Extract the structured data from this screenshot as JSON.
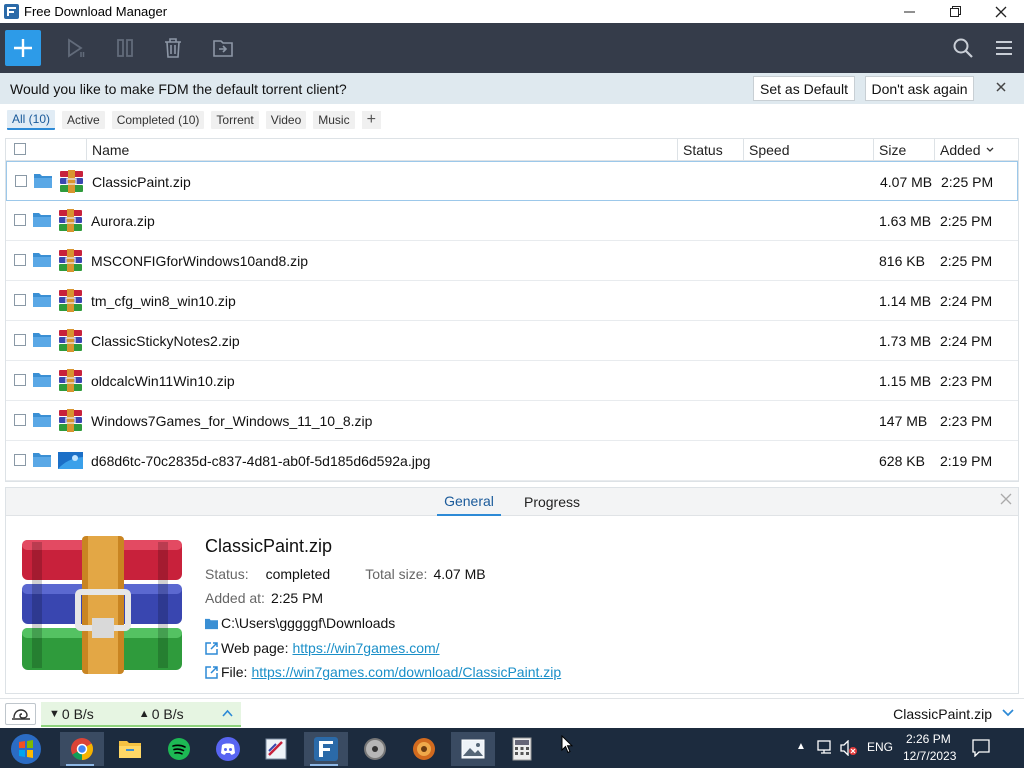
{
  "window": {
    "title": "Free Download Manager"
  },
  "notification": {
    "text": "Would you like to make FDM the default torrent client?",
    "set_default": "Set as Default",
    "dont_ask": "Don't ask again"
  },
  "filters": [
    "All (10)",
    "Active",
    "Completed (10)",
    "Torrent",
    "Video",
    "Music"
  ],
  "columns": {
    "name": "Name",
    "status": "Status",
    "speed": "Speed",
    "size": "Size",
    "added": "Added"
  },
  "downloads": [
    {
      "name": "ClassicPaint.zip",
      "size": "4.07 MB",
      "added": "2:25 PM"
    },
    {
      "name": "Aurora.zip",
      "size": "1.63 MB",
      "added": "2:25 PM"
    },
    {
      "name": "MSCONFIGforWindows10and8.zip",
      "size": "816 KB",
      "added": "2:25 PM"
    },
    {
      "name": "tm_cfg_win8_win10.zip",
      "size": "1.14 MB",
      "added": "2:24 PM"
    },
    {
      "name": "ClassicStickyNotes2.zip",
      "size": "1.73 MB",
      "added": "2:24 PM"
    },
    {
      "name": "oldcalcWin11Win10.zip",
      "size": "1.15 MB",
      "added": "2:23 PM"
    },
    {
      "name": "Windows7Games_for_Windows_11_10_8.zip",
      "size": "147 MB",
      "added": "2:23 PM"
    },
    {
      "name": "d68d6tc-70c2835d-c837-4d81-ab0f-5d185d6d592a.jpg",
      "size": "628 KB",
      "added": "2:19 PM"
    }
  ],
  "details": {
    "tabs": [
      "General",
      "Progress"
    ],
    "filename": "ClassicPaint.zip",
    "status_label": "Status:",
    "status_value": "completed",
    "total_label": "Total size:",
    "total_value": "4.07 MB",
    "added_label": "Added at:",
    "added_value": "2:25 PM",
    "path": "C:\\Users\\gggggf\\Downloads",
    "webpage_label": "Web page:",
    "webpage_url": "https://win7games.com/",
    "file_label": "File:",
    "file_url": "https://win7games.com/download/ClassicPaint.zip"
  },
  "statusbar": {
    "down_speed": "0 B/s",
    "up_speed": "0 B/s",
    "current_file": "ClassicPaint.zip"
  },
  "taskbar": {
    "lang": "ENG",
    "time": "2:26 PM",
    "date": "12/7/2023"
  },
  "colors": {
    "accent": "#2d9be8",
    "toolbar": "#353c4a",
    "taskbar": "#1c2b3e",
    "link": "#1a8fc8"
  }
}
